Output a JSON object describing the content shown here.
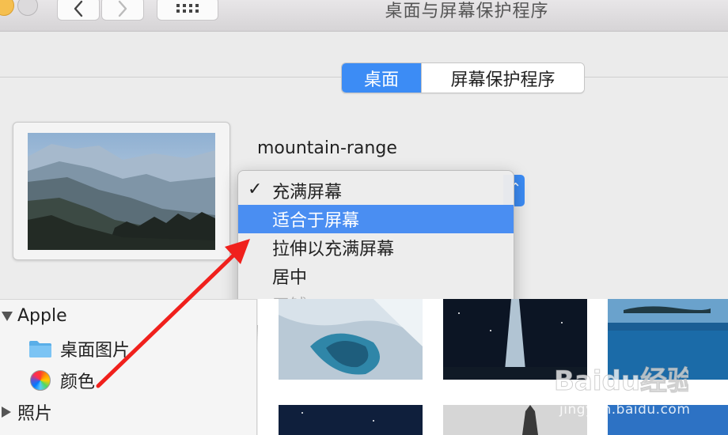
{
  "window": {
    "title": "桌面与屏幕保护程序"
  },
  "toolbar": {
    "back_icon": "chevron-left-icon",
    "forward_icon": "chevron-right-icon",
    "grid_icon": "grid-icon"
  },
  "tabs": [
    {
      "label": "桌面",
      "active": true
    },
    {
      "label": "屏幕保护程序",
      "active": false
    }
  ],
  "preview": {
    "filename": "mountain-range"
  },
  "fit_menu": {
    "items": [
      {
        "label": "充满屏幕",
        "checked": true,
        "highlighted": false,
        "enabled": true
      },
      {
        "label": "适合于屏幕",
        "checked": false,
        "highlighted": true,
        "enabled": true
      },
      {
        "label": "拉伸以充满屏幕",
        "checked": false,
        "highlighted": false,
        "enabled": true
      },
      {
        "label": "居中",
        "checked": false,
        "highlighted": false,
        "enabled": true
      },
      {
        "label": "平铺",
        "checked": false,
        "highlighted": false,
        "enabled": false
      }
    ],
    "check_mark": "✓"
  },
  "sidebar": {
    "groups": [
      {
        "label": "Apple",
        "expanded": true,
        "items": [
          {
            "label": "桌面图片",
            "icon": "folder-icon"
          },
          {
            "label": "颜色",
            "icon": "color-wheel-icon"
          }
        ]
      },
      {
        "label": "照片",
        "expanded": false,
        "items": []
      }
    ]
  },
  "colors": {
    "accent": "#3c8cf5",
    "highlight": "#4a8ef2",
    "annotation_arrow": "#f0201c"
  },
  "watermark": {
    "brand": "Baidu经验",
    "url": "jingyan.baidu.com"
  }
}
